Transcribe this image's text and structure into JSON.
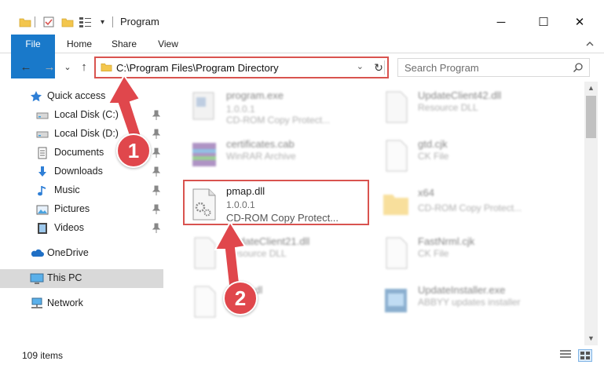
{
  "window": {
    "title": "Program",
    "minimize": "─",
    "maximize": "☐",
    "close": "✕"
  },
  "ribbon": {
    "tabs": [
      {
        "label": "File"
      },
      {
        "label": "Home"
      },
      {
        "label": "Share"
      },
      {
        "label": "View"
      }
    ]
  },
  "nav": {
    "back": "←",
    "forward": "→",
    "recent": "⌄",
    "up": "↑",
    "address": "C:\\Program Files\\Program Directory",
    "address_chevron": "⌄",
    "refresh": "↻",
    "search_placeholder": "Search Program"
  },
  "sidebar": {
    "items": [
      {
        "label": "Quick access",
        "icon": "star-icon"
      },
      {
        "label": "Local Disk (C:)",
        "icon": "drive-icon",
        "pinned": true
      },
      {
        "label": "Local Disk (D:)",
        "icon": "drive-icon",
        "pinned": true
      },
      {
        "label": "Documents",
        "icon": "documents-icon",
        "pinned": true
      },
      {
        "label": "Downloads",
        "icon": "download-icon",
        "pinned": true
      },
      {
        "label": "Music",
        "icon": "music-icon",
        "pinned": true
      },
      {
        "label": "Pictures",
        "icon": "pictures-icon",
        "pinned": true
      },
      {
        "label": "Videos",
        "icon": "videos-icon",
        "pinned": true
      },
      {
        "label": "OneDrive",
        "icon": "cloud-icon"
      },
      {
        "label": "This PC",
        "icon": "computer-icon",
        "selected": true
      },
      {
        "label": "Network",
        "icon": "network-icon"
      }
    ]
  },
  "files": [
    {
      "name": "program.exe",
      "version": "1.0.0.1",
      "desc": "CD-ROM Copy Protect...",
      "icon": "exe-icon"
    },
    {
      "name": "UpdateClient42.dll",
      "version": "",
      "desc": "Resource DLL",
      "icon": "dll-icon"
    },
    {
      "name": "certificates.cab",
      "version": "",
      "desc": "WinRAR Archive",
      "icon": "archive-icon"
    },
    {
      "name": "gtd.cjk",
      "version": "",
      "desc": "CK File",
      "icon": "file-icon"
    },
    {
      "name": "pmap.dll",
      "version": "1.0.0.1",
      "desc": "CD-ROM Copy Protect...",
      "icon": "dll-icon"
    },
    {
      "name": "x64",
      "version": "",
      "desc": "CD-ROM Copy Protect...",
      "icon": "folder-icon"
    },
    {
      "name": "UpdateClient21.dll",
      "version": "",
      "desc": "Resource DLL",
      "icon": "dll-icon"
    },
    {
      "name": "FastNrml.cjk",
      "version": "",
      "desc": "CK File",
      "icon": "file-icon"
    },
    {
      "name": "pmap.dl",
      "version": "",
      "desc": "",
      "icon": "file-icon"
    },
    {
      "name": "UpdateInstaller.exe",
      "version": "",
      "desc": "ABBYY updates installer",
      "icon": "installer-icon"
    }
  ],
  "status": {
    "item_count": "109 items"
  },
  "annotations": {
    "badge1": "1",
    "badge2": "2"
  },
  "colors": {
    "accent": "#1979ca",
    "highlight": "#d9534f",
    "badge": "#e0474c"
  }
}
